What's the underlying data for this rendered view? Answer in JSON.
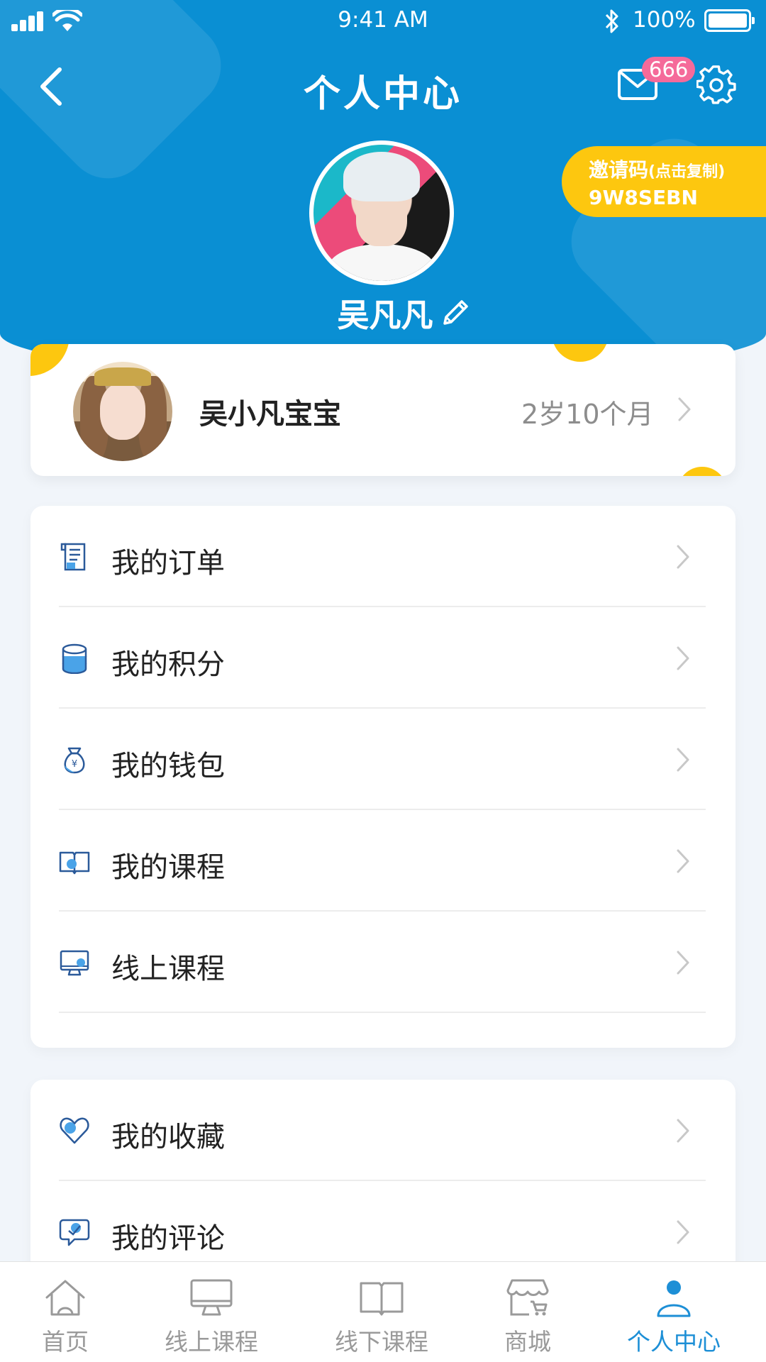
{
  "status_bar": {
    "time": "9:41 AM",
    "battery": "100%"
  },
  "header": {
    "title": "个人中心",
    "unread_count": "666"
  },
  "profile": {
    "username": "吴凡凡",
    "invite": {
      "label": "邀请码",
      "hint": "(点击复制)",
      "code": "9W8SEBN"
    }
  },
  "child": {
    "name": "吴小凡宝宝",
    "age": "2岁10个月"
  },
  "menu_main": [
    {
      "label": "我的订单",
      "icon": "order-icon"
    },
    {
      "label": "我的积分",
      "icon": "coins-icon"
    },
    {
      "label": "我的钱包",
      "icon": "money-bag-icon"
    },
    {
      "label": "我的课程",
      "icon": "book-icon"
    },
    {
      "label": "线上课程",
      "icon": "monitor-icon"
    }
  ],
  "menu_secondary": [
    {
      "label": "我的收藏",
      "icon": "heart-icon"
    },
    {
      "label": "我的评论",
      "icon": "comment-icon"
    }
  ],
  "tabbar": [
    {
      "label": "首页",
      "icon": "home-icon"
    },
    {
      "label": "线上课程",
      "icon": "monitor-icon"
    },
    {
      "label": "线下课程",
      "icon": "book-icon"
    },
    {
      "label": "商城",
      "icon": "shop-icon"
    },
    {
      "label": "个人中心",
      "icon": "person-icon",
      "active": true
    }
  ],
  "colors": {
    "primary": "#0a8fd3",
    "accent_yellow": "#fdc70f",
    "badge_pink": "#f56a9a",
    "tab_active": "#1d8fd6"
  }
}
